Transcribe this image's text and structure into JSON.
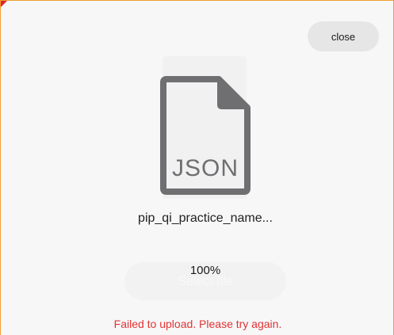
{
  "dialog": {
    "close_label": "close"
  },
  "file": {
    "extension": "JSON",
    "name": "pip_qi_practice_name...",
    "icon": "file-json-icon"
  },
  "upload": {
    "select_label": "Select file",
    "progress_percent": 100,
    "progress_text": "100%",
    "error_text": "Failed to upload. Please try again."
  },
  "colors": {
    "accent_border": "#f0a030",
    "error": "#e23333",
    "icon_gray": "#6f6f71"
  }
}
